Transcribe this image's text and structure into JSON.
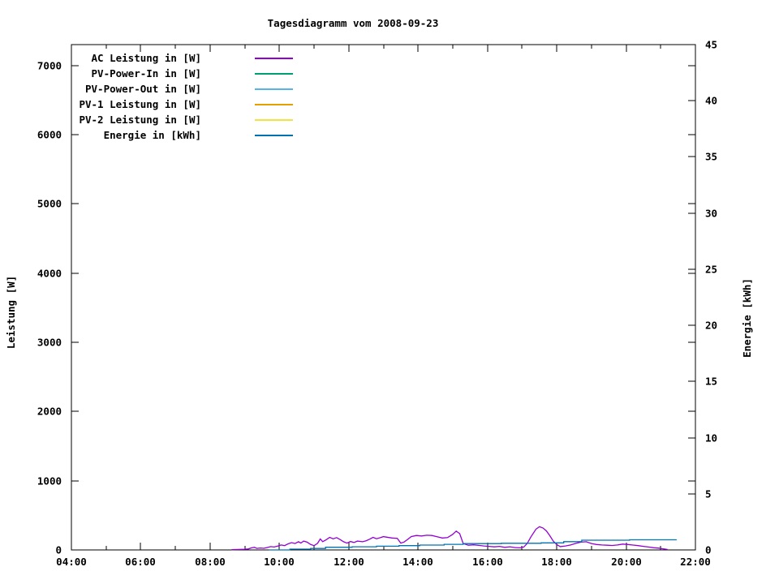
{
  "chart_data": {
    "type": "line",
    "title": "Tagesdiagramm vom 2008-09-23",
    "background": "#ffffff",
    "grid": false,
    "legend_position": "top-left-inside",
    "x_axis": {
      "label": "",
      "min_hour": 4,
      "max_hour": 22,
      "major_tick_hours": [
        4,
        6,
        8,
        10,
        12,
        14,
        16,
        18,
        20,
        22
      ],
      "minor_tick_hours": [
        5,
        7,
        9,
        11,
        13,
        15,
        17,
        19,
        21
      ],
      "tick_labels": [
        "04:00",
        "06:00",
        "08:00",
        "10:00",
        "12:00",
        "14:00",
        "16:00",
        "18:00",
        "20:00",
        "22:00"
      ]
    },
    "y_left": {
      "label": "Leistung [W]",
      "min": 0,
      "max": 7300,
      "tick_values": [
        0,
        1000,
        2000,
        3000,
        4000,
        5000,
        6000,
        7000
      ],
      "tick_labels": [
        "0",
        "1000",
        "2000",
        "3000",
        "4000",
        "5000",
        "6000",
        "7000"
      ]
    },
    "y_right": {
      "label": "Energie [kWh]",
      "min": 0,
      "max": 45,
      "tick_values": [
        0,
        5,
        10,
        15,
        20,
        25,
        30,
        35,
        40,
        45
      ],
      "tick_labels": [
        "0",
        "5",
        "10",
        "15",
        "20",
        "25",
        "30",
        "35",
        "40",
        "45"
      ]
    },
    "series": [
      {
        "name": "AC Leistung in [W]",
        "color": "#9400d3",
        "axis": "left",
        "mode": "line",
        "points": [
          [
            8.62,
            3
          ],
          [
            8.75,
            6
          ],
          [
            8.9,
            8
          ],
          [
            9.0,
            10
          ],
          [
            9.1,
            14
          ],
          [
            9.2,
            30
          ],
          [
            9.28,
            38
          ],
          [
            9.35,
            22
          ],
          [
            9.45,
            28
          ],
          [
            9.55,
            24
          ],
          [
            9.65,
            35
          ],
          [
            9.75,
            48
          ],
          [
            9.85,
            42
          ],
          [
            9.95,
            55
          ],
          [
            10.05,
            72
          ],
          [
            10.15,
            62
          ],
          [
            10.25,
            88
          ],
          [
            10.35,
            105
          ],
          [
            10.45,
            92
          ],
          [
            10.55,
            118
          ],
          [
            10.62,
            100
          ],
          [
            10.7,
            128
          ],
          [
            10.8,
            112
          ],
          [
            10.9,
            78
          ],
          [
            11.0,
            62
          ],
          [
            11.1,
            95
          ],
          [
            11.18,
            158
          ],
          [
            11.25,
            120
          ],
          [
            11.35,
            148
          ],
          [
            11.45,
            182
          ],
          [
            11.55,
            160
          ],
          [
            11.65,
            178
          ],
          [
            11.75,
            150
          ],
          [
            11.85,
            118
          ],
          [
            11.95,
            98
          ],
          [
            12.05,
            122
          ],
          [
            12.15,
            108
          ],
          [
            12.25,
            128
          ],
          [
            12.4,
            118
          ],
          [
            12.5,
            132
          ],
          [
            12.6,
            155
          ],
          [
            12.7,
            182
          ],
          [
            12.8,
            162
          ],
          [
            12.9,
            176
          ],
          [
            13.0,
            192
          ],
          [
            13.1,
            184
          ],
          [
            13.25,
            172
          ],
          [
            13.4,
            168
          ],
          [
            13.5,
            98
          ],
          [
            13.6,
            115
          ],
          [
            13.7,
            152
          ],
          [
            13.8,
            192
          ],
          [
            13.95,
            208
          ],
          [
            14.1,
            202
          ],
          [
            14.25,
            212
          ],
          [
            14.4,
            208
          ],
          [
            14.55,
            190
          ],
          [
            14.7,
            172
          ],
          [
            14.85,
            178
          ],
          [
            15.0,
            225
          ],
          [
            15.1,
            272
          ],
          [
            15.2,
            235
          ],
          [
            15.3,
            92
          ],
          [
            15.45,
            68
          ],
          [
            15.6,
            74
          ],
          [
            15.75,
            66
          ],
          [
            15.9,
            58
          ],
          [
            16.05,
            52
          ],
          [
            16.2,
            44
          ],
          [
            16.35,
            52
          ],
          [
            16.5,
            38
          ],
          [
            16.65,
            46
          ],
          [
            16.8,
            34
          ],
          [
            16.95,
            30
          ],
          [
            17.05,
            42
          ],
          [
            17.15,
            95
          ],
          [
            17.25,
            185
          ],
          [
            17.4,
            300
          ],
          [
            17.5,
            335
          ],
          [
            17.6,
            318
          ],
          [
            17.7,
            275
          ],
          [
            17.8,
            205
          ],
          [
            17.9,
            128
          ],
          [
            18.0,
            78
          ],
          [
            18.1,
            48
          ],
          [
            18.25,
            58
          ],
          [
            18.4,
            72
          ],
          [
            18.55,
            95
          ],
          [
            18.7,
            112
          ],
          [
            18.85,
            118
          ],
          [
            19.0,
            92
          ],
          [
            19.15,
            78
          ],
          [
            19.3,
            72
          ],
          [
            19.45,
            68
          ],
          [
            19.6,
            64
          ],
          [
            19.75,
            72
          ],
          [
            19.9,
            84
          ],
          [
            20.05,
            78
          ],
          [
            20.2,
            70
          ],
          [
            20.35,
            62
          ],
          [
            20.5,
            52
          ],
          [
            20.65,
            42
          ],
          [
            20.8,
            32
          ],
          [
            20.95,
            26
          ],
          [
            21.05,
            18
          ],
          [
            21.15,
            10
          ],
          [
            21.2,
            6
          ]
        ]
      },
      {
        "name": "PV-Power-In in [W]",
        "color": "#009e73",
        "axis": "left",
        "mode": "line",
        "points": []
      },
      {
        "name": "PV-Power-Out in [W]",
        "color": "#56b4e9",
        "axis": "left",
        "mode": "line",
        "points": []
      },
      {
        "name": "PV-1 Leistung in [W]",
        "color": "#e69f00",
        "axis": "left",
        "mode": "line",
        "points": []
      },
      {
        "name": "PV-2 Leistung in [W]",
        "color": "#f0e442",
        "axis": "left",
        "mode": "line",
        "points": []
      },
      {
        "name": "Energie in [kWh]",
        "color": "#0072b2",
        "axis": "right",
        "mode": "step",
        "points": [
          [
            9.7,
            0.0
          ],
          [
            10.3,
            0.07
          ],
          [
            10.9,
            0.13
          ],
          [
            11.33,
            0.24
          ],
          [
            12.1,
            0.28
          ],
          [
            12.8,
            0.33
          ],
          [
            13.45,
            0.38
          ],
          [
            14.05,
            0.43
          ],
          [
            14.75,
            0.5
          ],
          [
            15.3,
            0.56
          ],
          [
            16.4,
            0.59
          ],
          [
            17.55,
            0.63
          ],
          [
            18.2,
            0.74
          ],
          [
            18.72,
            0.87
          ],
          [
            20.1,
            0.9
          ],
          [
            21.45,
            0.92
          ]
        ]
      }
    ]
  }
}
